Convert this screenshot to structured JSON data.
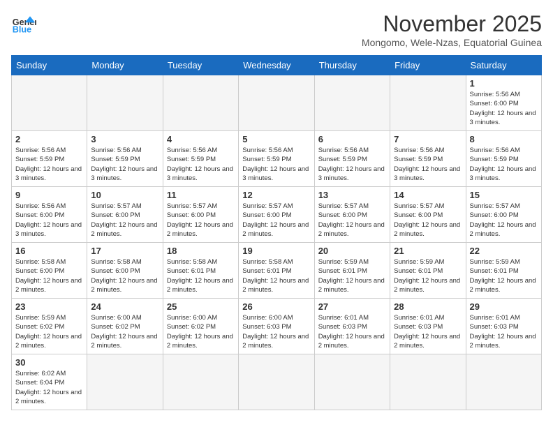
{
  "logo": {
    "text_general": "General",
    "text_blue": "Blue"
  },
  "header": {
    "month": "November 2025",
    "location": "Mongomo, Wele-Nzas, Equatorial Guinea"
  },
  "days_of_week": [
    "Sunday",
    "Monday",
    "Tuesday",
    "Wednesday",
    "Thursday",
    "Friday",
    "Saturday"
  ],
  "weeks": [
    [
      {
        "day": "",
        "empty": true
      },
      {
        "day": "",
        "empty": true
      },
      {
        "day": "",
        "empty": true
      },
      {
        "day": "",
        "empty": true
      },
      {
        "day": "",
        "empty": true
      },
      {
        "day": "",
        "empty": true
      },
      {
        "day": "1",
        "sunrise": "5:56 AM",
        "sunset": "6:00 PM",
        "daylight": "12 hours and 3 minutes."
      }
    ],
    [
      {
        "day": "2",
        "sunrise": "5:56 AM",
        "sunset": "5:59 PM",
        "daylight": "12 hours and 3 minutes."
      },
      {
        "day": "3",
        "sunrise": "5:56 AM",
        "sunset": "5:59 PM",
        "daylight": "12 hours and 3 minutes."
      },
      {
        "day": "4",
        "sunrise": "5:56 AM",
        "sunset": "5:59 PM",
        "daylight": "12 hours and 3 minutes."
      },
      {
        "day": "5",
        "sunrise": "5:56 AM",
        "sunset": "5:59 PM",
        "daylight": "12 hours and 3 minutes."
      },
      {
        "day": "6",
        "sunrise": "5:56 AM",
        "sunset": "5:59 PM",
        "daylight": "12 hours and 3 minutes."
      },
      {
        "day": "7",
        "sunrise": "5:56 AM",
        "sunset": "5:59 PM",
        "daylight": "12 hours and 3 minutes."
      },
      {
        "day": "8",
        "sunrise": "5:56 AM",
        "sunset": "5:59 PM",
        "daylight": "12 hours and 3 minutes."
      }
    ],
    [
      {
        "day": "9",
        "sunrise": "5:56 AM",
        "sunset": "6:00 PM",
        "daylight": "12 hours and 3 minutes."
      },
      {
        "day": "10",
        "sunrise": "5:57 AM",
        "sunset": "6:00 PM",
        "daylight": "12 hours and 2 minutes."
      },
      {
        "day": "11",
        "sunrise": "5:57 AM",
        "sunset": "6:00 PM",
        "daylight": "12 hours and 2 minutes."
      },
      {
        "day": "12",
        "sunrise": "5:57 AM",
        "sunset": "6:00 PM",
        "daylight": "12 hours and 2 minutes."
      },
      {
        "day": "13",
        "sunrise": "5:57 AM",
        "sunset": "6:00 PM",
        "daylight": "12 hours and 2 minutes."
      },
      {
        "day": "14",
        "sunrise": "5:57 AM",
        "sunset": "6:00 PM",
        "daylight": "12 hours and 2 minutes."
      },
      {
        "day": "15",
        "sunrise": "5:57 AM",
        "sunset": "6:00 PM",
        "daylight": "12 hours and 2 minutes."
      }
    ],
    [
      {
        "day": "16",
        "sunrise": "5:58 AM",
        "sunset": "6:00 PM",
        "daylight": "12 hours and 2 minutes."
      },
      {
        "day": "17",
        "sunrise": "5:58 AM",
        "sunset": "6:00 PM",
        "daylight": "12 hours and 2 minutes."
      },
      {
        "day": "18",
        "sunrise": "5:58 AM",
        "sunset": "6:01 PM",
        "daylight": "12 hours and 2 minutes."
      },
      {
        "day": "19",
        "sunrise": "5:58 AM",
        "sunset": "6:01 PM",
        "daylight": "12 hours and 2 minutes."
      },
      {
        "day": "20",
        "sunrise": "5:59 AM",
        "sunset": "6:01 PM",
        "daylight": "12 hours and 2 minutes."
      },
      {
        "day": "21",
        "sunrise": "5:59 AM",
        "sunset": "6:01 PM",
        "daylight": "12 hours and 2 minutes."
      },
      {
        "day": "22",
        "sunrise": "5:59 AM",
        "sunset": "6:01 PM",
        "daylight": "12 hours and 2 minutes."
      }
    ],
    [
      {
        "day": "23",
        "sunrise": "5:59 AM",
        "sunset": "6:02 PM",
        "daylight": "12 hours and 2 minutes."
      },
      {
        "day": "24",
        "sunrise": "6:00 AM",
        "sunset": "6:02 PM",
        "daylight": "12 hours and 2 minutes."
      },
      {
        "day": "25",
        "sunrise": "6:00 AM",
        "sunset": "6:02 PM",
        "daylight": "12 hours and 2 minutes."
      },
      {
        "day": "26",
        "sunrise": "6:00 AM",
        "sunset": "6:03 PM",
        "daylight": "12 hours and 2 minutes."
      },
      {
        "day": "27",
        "sunrise": "6:01 AM",
        "sunset": "6:03 PM",
        "daylight": "12 hours and 2 minutes."
      },
      {
        "day": "28",
        "sunrise": "6:01 AM",
        "sunset": "6:03 PM",
        "daylight": "12 hours and 2 minutes."
      },
      {
        "day": "29",
        "sunrise": "6:01 AM",
        "sunset": "6:03 PM",
        "daylight": "12 hours and 2 minutes."
      }
    ],
    [
      {
        "day": "30",
        "sunrise": "6:02 AM",
        "sunset": "6:04 PM",
        "daylight": "12 hours and 2 minutes."
      },
      {
        "day": "",
        "empty": true
      },
      {
        "day": "",
        "empty": true
      },
      {
        "day": "",
        "empty": true
      },
      {
        "day": "",
        "empty": true
      },
      {
        "day": "",
        "empty": true
      },
      {
        "day": "",
        "empty": true
      }
    ]
  ],
  "labels": {
    "sunrise": "Sunrise:",
    "sunset": "Sunset:",
    "daylight": "Daylight:"
  }
}
